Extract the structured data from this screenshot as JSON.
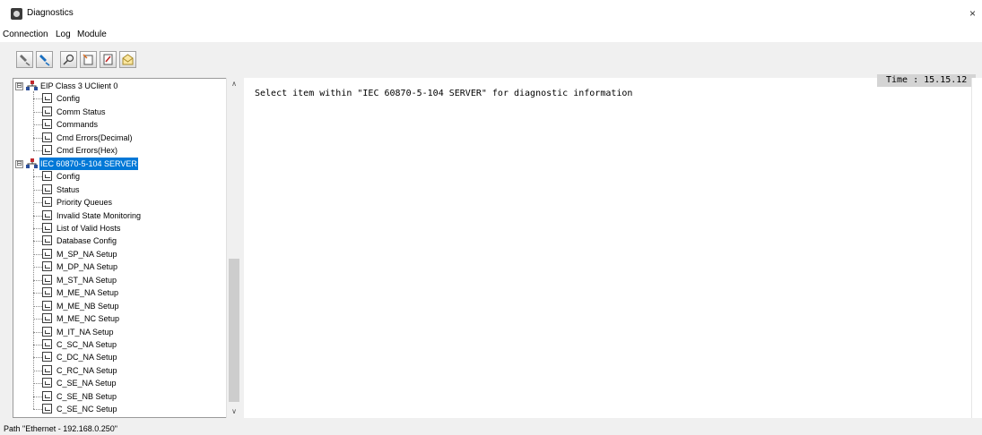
{
  "window": {
    "title": "Diagnostics",
    "close_glyph": "×"
  },
  "menu": [
    "Connection",
    "Log",
    "Module"
  ],
  "toolbar": [
    "disconnect-icon",
    "connect-icon",
    "find-icon",
    "log-icon",
    "print-icon",
    "open-icon"
  ],
  "tree": {
    "roots": [
      {
        "label": "EIP Class 3 UClient 0",
        "expander": "⊟",
        "selected": false,
        "children": [
          "Config",
          "Comm Status",
          "Commands",
          "Cmd Errors(Decimal)",
          "Cmd Errors(Hex)"
        ]
      },
      {
        "label": "IEC 60870-5-104 SERVER",
        "expander": "⊟",
        "selected": true,
        "children": [
          "Config",
          "Status",
          "Priority Queues",
          "Invalid State Monitoring",
          "List of Valid Hosts",
          "Database Config",
          "M_SP_NA Setup",
          "M_DP_NA Setup",
          "M_ST_NA Setup",
          "M_ME_NA Setup",
          "M_ME_NB Setup",
          "M_ME_NC Setup",
          "M_IT_NA Setup",
          "C_SC_NA Setup",
          "C_DC_NA Setup",
          "C_RC_NA Setup",
          "C_SE_NA Setup",
          "C_SE_NB Setup",
          "C_SE_NC Setup"
        ]
      }
    ]
  },
  "detail": {
    "message": "Select item within \"IEC 60870-5-104 SERVER\" for diagnostic information",
    "time_label": "Time : 15.15.12"
  },
  "scrollbar": {
    "up": "∧",
    "down": "∨"
  },
  "status": {
    "path": "Path \"Ethernet - 192.168.0.250\""
  },
  "colors": {
    "selection": "#0078d7",
    "background": "#f0f0f0",
    "panel": "#ffffff"
  }
}
